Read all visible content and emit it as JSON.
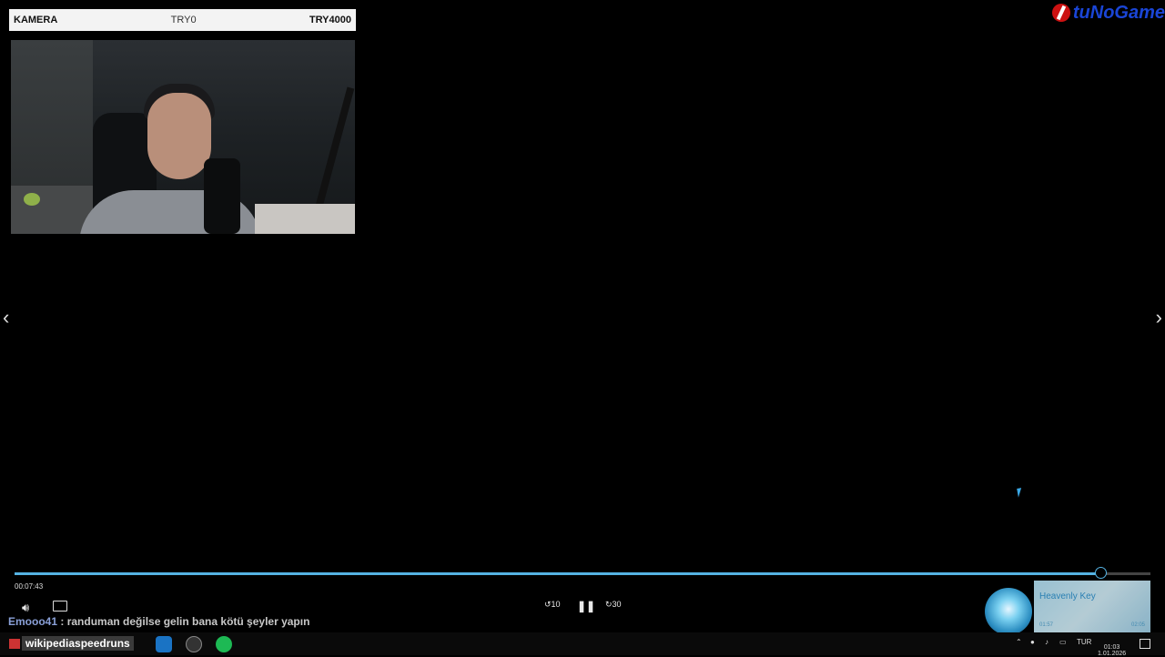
{
  "camera": {
    "label": "KAMERA",
    "try_label": "TRY0",
    "goal_label": "TRY4000"
  },
  "logo": {
    "text": "tuNoGame"
  },
  "player": {
    "current_time": "00:07:43",
    "progress_fraction": 0.957,
    "rewind_label": "10",
    "forward_label": "30"
  },
  "chat": {
    "user": "Emooo41",
    "separator": " : ",
    "message": "randuman değilse gelin bana kötü şeyler yapın"
  },
  "music": {
    "track": "Heavenly Key",
    "elapsed": "01:57",
    "total": "02:05"
  },
  "taskbar": {
    "window_label": "wikipediaspeedruns",
    "language": "TUR",
    "date": "1.01.2026",
    "time": "01:03"
  },
  "colors": {
    "accent": "#55b3e3",
    "chat_user": "#8aa0d8",
    "logo": "#1a45d6"
  }
}
